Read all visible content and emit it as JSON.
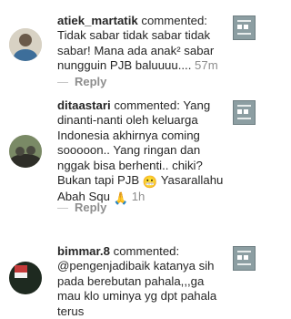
{
  "comments": [
    {
      "username": "atiek_martatik",
      "verb": "commented:",
      "text": "Tidak sabar tidak sabar tidak sabar! Mana ada anak² sabar nungguin PJB baluuuu....",
      "time": "57m",
      "reply_label": "Reply"
    },
    {
      "username": "ditaastari",
      "verb": "commented:",
      "text": "Yang dinanti-nanti oleh keluarga Indonesia akhirnya coming sooooon.. Yang ringan dan nggak bisa berhenti.. chiki? Bukan tapi PJB",
      "emoji_1": "😬",
      "text_2": "Yasarallahu Abah Squ",
      "emoji_2": "🙏",
      "time": "1h",
      "reply_label": "Reply"
    },
    {
      "username": "bimmar.8",
      "verb": "commented:",
      "text": "@pengenjadibaik katanya sih pada berebutan pahala,,,ga mau klo uminya yg dpt pahala terus"
    }
  ],
  "icons": {
    "avatar": "user-avatar-icon",
    "thumbnail": "post-thumbnail-icon"
  },
  "colors": {
    "text": "#262626",
    "muted": "#8e8e8e",
    "reply_dash": "#c7c7c7"
  }
}
